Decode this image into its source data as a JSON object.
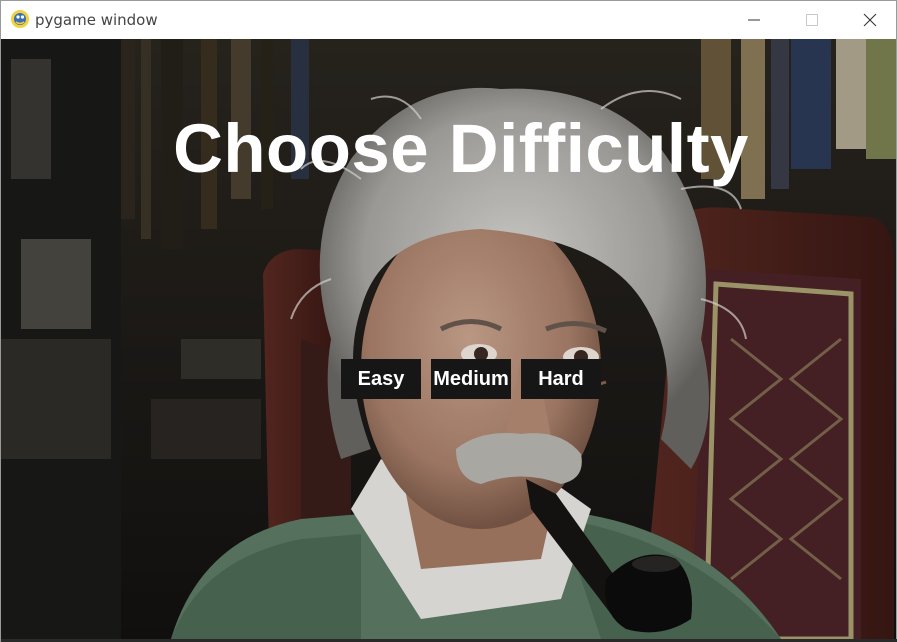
{
  "window": {
    "title": "pygame window",
    "app_icon": "pygame-snake-icon",
    "controls": {
      "minimize_icon": "minimize-icon",
      "maximize_icon": "maximize-icon",
      "close_icon": "close-icon"
    }
  },
  "game": {
    "heading": "Choose Difficulty",
    "background": "portrait-photo",
    "buttons": [
      {
        "label": "Easy"
      },
      {
        "label": "Medium"
      },
      {
        "label": "Hard"
      }
    ]
  },
  "colors": {
    "button_bg": "#161616",
    "button_text": "#ffffff",
    "heading_text": "#ffffff"
  }
}
